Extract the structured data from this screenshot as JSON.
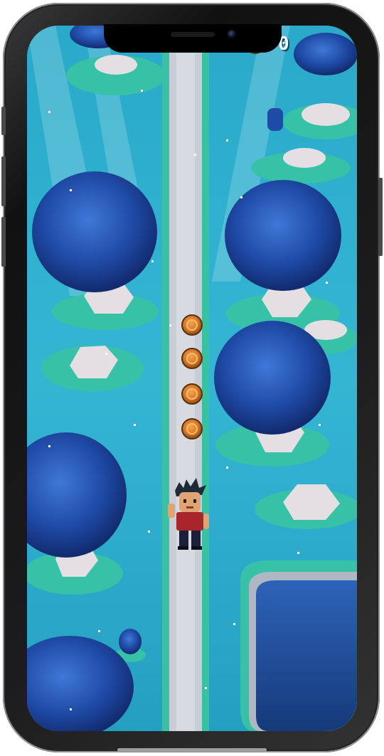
{
  "hud": {
    "score": "0",
    "coin_icon": "coin-icon"
  },
  "colors": {
    "background": "#2aa9c9",
    "path": "#c9ced6",
    "grass": "#37c2a8",
    "tree_dark": "#16307a",
    "tree_light": "#3f78d8",
    "stump": "#e4dfe2",
    "coin": "#d6782a",
    "lake": "#1e4a8f"
  },
  "game": {
    "coins_on_path": 4
  }
}
